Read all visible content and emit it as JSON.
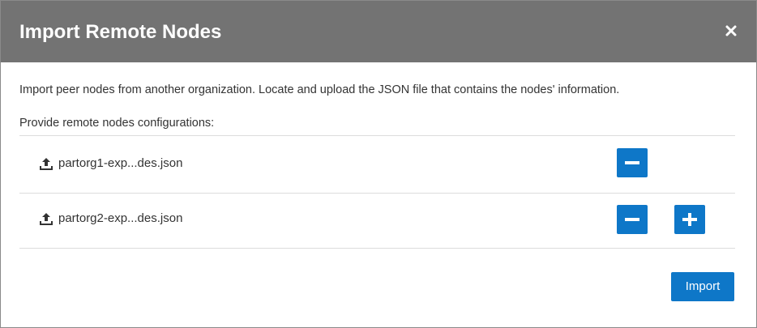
{
  "dialog": {
    "title": "Import Remote Nodes",
    "close_icon": "close-icon",
    "description": "Import peer nodes from another organization. Locate and upload the JSON file that contains the nodes' information.",
    "configurations_label": "Provide remote nodes configurations:",
    "nodes": [
      {
        "file_name": "partorg1-exp...des.json",
        "icon": "upload-icon",
        "remove_icon": "minus-icon"
      },
      {
        "file_name": "partorg2-exp...des.json",
        "icon": "upload-icon",
        "remove_icon": "minus-icon",
        "add_icon": "plus-icon"
      }
    ],
    "import_label": "Import"
  },
  "colors": {
    "header_bg": "#737373",
    "accent": "#0e77c8",
    "text": "#333333",
    "divider": "#dcdcdc"
  }
}
